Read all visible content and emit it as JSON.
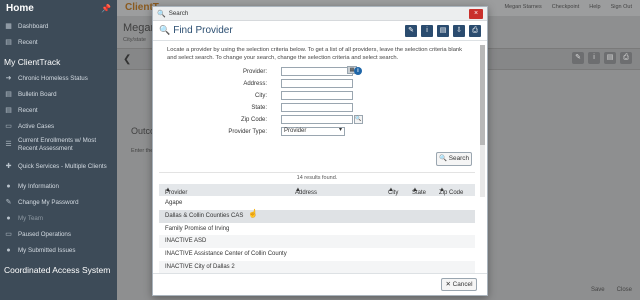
{
  "sidebar": {
    "home_title": "Home",
    "home_items": [
      {
        "label": "Dashboard",
        "icon": "dashboard-icon"
      },
      {
        "label": "Recent",
        "icon": "recent-icon"
      }
    ],
    "section_title": "My ClientTrack",
    "items": [
      {
        "label": "Chronic Homeless Status",
        "icon": "arrow-icon"
      },
      {
        "label": "Bulletin Board",
        "icon": "board-icon"
      },
      {
        "label": "Recent",
        "icon": "recent-icon"
      },
      {
        "label": "Active Cases",
        "icon": "folder-icon"
      },
      {
        "label": "Current Enrollments w/ Most Recent Assessment",
        "icon": "list-icon"
      },
      {
        "label": "Quick Services - Multiple Clients",
        "icon": "service-icon"
      },
      {
        "label": "My Information",
        "icon": "user-icon"
      },
      {
        "label": "Change My Password",
        "icon": "lock-icon"
      },
      {
        "label": "My Team",
        "icon": "team-icon"
      },
      {
        "label": "Paused Operations",
        "icon": "pause-icon"
      },
      {
        "label": "My Submitted Issues",
        "icon": "issue-icon"
      }
    ],
    "bottom_section": "Coordinated Access System"
  },
  "app": {
    "logo": "ClientT",
    "user_links": [
      "Megan Starnes",
      "Checkpoint",
      "Help",
      "Sign Out"
    ],
    "client_name": "Megan",
    "client_sub": "City/state",
    "outcome_heading": "Outco",
    "enter_text": "Enter the",
    "footer_buttons": [
      "Save",
      "Close"
    ]
  },
  "modal": {
    "window_title": "Search",
    "close_label": "×",
    "header_title": "Find Provider",
    "instructions": "Locate a provider by using the selection criteria below. To get a list of all providers, leave the selection criteria blank and select search. To change your search, change the selection criteria and select search.",
    "fields": {
      "provider": {
        "label": "Provider:",
        "value": ""
      },
      "address": {
        "label": "Address:",
        "value": ""
      },
      "city": {
        "label": "City:",
        "value": ""
      },
      "state": {
        "label": "State:",
        "value": ""
      },
      "zip": {
        "label": "Zip Code:",
        "value": ""
      },
      "provider_type": {
        "label": "Provider Type:",
        "value": "Provider"
      }
    },
    "search_button": "Search",
    "results_count": "14 results found.",
    "columns": [
      "Provider",
      "Address",
      "City",
      "State",
      "Zip Code"
    ],
    "rows": [
      "Agape",
      "Dallas & Collin Counties CAS",
      "Family Promise of Irving",
      "INACTIVE ASD",
      "INACTIVE Assistance Center of Collin County",
      "INACTIVE City of Dallas 2"
    ],
    "cancel_button": "Cancel"
  }
}
